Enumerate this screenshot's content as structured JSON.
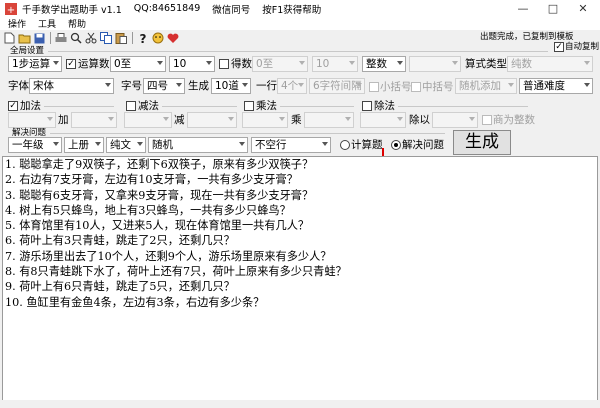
{
  "title": {
    "app_name": "千手数学出题助手 v1.1",
    "qq": "QQ:84651849",
    "wechat": "微信同号",
    "help_hint": "按F1获得帮助"
  },
  "window_controls": [
    "—",
    "□",
    "✕"
  ],
  "menu": [
    "操作",
    "工具",
    "帮助"
  ],
  "toolbar_icons": [
    "new-file-icon",
    "open-folder-icon",
    "save-icon",
    "print-icon",
    "search-icon",
    "cut-icon",
    "copy-icon",
    "paste-icon",
    "help-icon",
    "face-icon",
    "heart-icon"
  ],
  "status": {
    "message": "出题完成，已复制到模板",
    "auto_copy_label": "自动复制",
    "auto_copy_checked": true
  },
  "global": {
    "section_label": "全局设置",
    "steps": "1步运算",
    "operand_count_label": "运算数",
    "operand_count_checked": true,
    "range_from": "0至",
    "range_to": "10",
    "result_label": "得数",
    "result_checked": false,
    "result_from": "0至",
    "result_to": "10",
    "number_type": "整数",
    "blank_select": "",
    "formula_type_label": "算式类型",
    "formula_type_value": "纯数"
  },
  "font": {
    "font_label": "字体",
    "font_value": "宋体",
    "size_label": "字号",
    "size_value": "四号",
    "generate_label": "生成",
    "generate_value": "10道",
    "per_line_label": "一行",
    "per_line_value": "4个",
    "spacing_value": "6字符间隔",
    "small_bracket_label": "小括号",
    "mid_bracket_label": "中括号",
    "random_add": "随机添加",
    "difficulty": "普通难度"
  },
  "ops": {
    "add": {
      "label": "加法",
      "checked": true,
      "op_label": "加"
    },
    "sub": {
      "label": "减法",
      "checked": false,
      "op_label": "减"
    },
    "mul": {
      "label": "乘法",
      "checked": false,
      "op_label": "乘"
    },
    "div": {
      "label": "除法",
      "checked": false,
      "op_label": "除以",
      "int_quotient_label": "商为整数"
    }
  },
  "solve": {
    "section_label": "解决问题",
    "grade": "一年级",
    "volume": "上册",
    "style": "纯文",
    "order": "随机",
    "line_mode": "不空行",
    "calc_label": "计算题",
    "solve_label": "解决问题",
    "mode_selected": "solve",
    "generate_button": "生成"
  },
  "problems": [
    "1. 聪聪拿走了9双筷子，还剩下6双筷子，原来有多少双筷子？",
    "2. 右边有7支牙膏，左边有10支牙膏，一共有多少支牙膏？",
    "3. 聪聪有6支牙膏，又拿来9支牙膏，现在一共有多少支牙膏？",
    "4. 树上有5只蜂鸟，地上有3只蜂鸟，一共有多少只蜂鸟？",
    "5. 体育馆里有10人，又进来5人，现在体育馆里一共有几人？",
    "6. 荷叶上有3只青蛙，跳走了2只，还剩几只？",
    "7. 游乐场里出去了10个人，还剩9个人，游乐场里原来有多少人？",
    "8. 有8只青蛙跳下水了，荷叶上还有7只，荷叶上原来有多少只青蛙？",
    "9. 荷叶上有6只青蛙，跳走了5只，还剩几只？",
    "10. 鱼缸里有金鱼4条，左边有3条，右边有多少条？"
  ]
}
